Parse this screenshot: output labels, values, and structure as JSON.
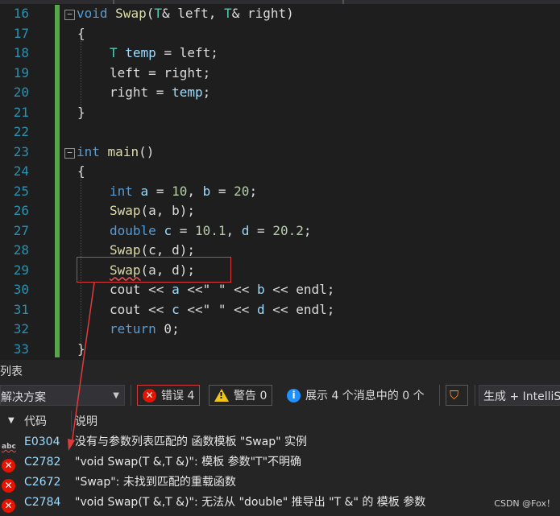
{
  "editor": {
    "line_numbers": [
      "16",
      "17",
      "18",
      "19",
      "20",
      "21",
      "22",
      "23",
      "24",
      "25",
      "26",
      "27",
      "28",
      "29",
      "30",
      "31",
      "32",
      "33"
    ],
    "code": {
      "l16": {
        "kw": "void",
        "fn": "Swap",
        "rest1": "(",
        "ty1": "T",
        "rest2": "& left, ",
        "ty2": "T",
        "rest3": "& right)"
      },
      "l17": "{",
      "l18": {
        "ty": "T",
        "var": "temp",
        "rest": " = left;"
      },
      "l19": "left = right;",
      "l20": {
        "rest": "right = ",
        "var": "temp",
        "end": ";"
      },
      "l21": "}",
      "l23": {
        "kw": "int",
        "fn": "main",
        "rest": "()"
      },
      "l24": "{",
      "l25": {
        "kw": "int",
        "a": "a",
        "eq1": " = ",
        "n1": "10",
        "c": ", ",
        "b": "b",
        "eq2": " = ",
        "n2": "20",
        "end": ";"
      },
      "l26": {
        "fn": "Swap",
        "args": "(a, b);"
      },
      "l27": {
        "kw": "double",
        "c": "c",
        "eq1": " = ",
        "n1": "10.1",
        "s": ", ",
        "d": "d",
        "eq2": " = ",
        "n2": "20.2",
        "end": ";"
      },
      "l28": {
        "fn": "Swap",
        "args": "(c, d);"
      },
      "l29": {
        "fn": "Swap",
        "args": "(a, d);"
      },
      "l30": {
        "p1": "cout << ",
        "v1": "a",
        "p2": " <<\" \" << ",
        "v2": "b",
        "p3": " << endl;"
      },
      "l31": {
        "p1": "cout << ",
        "v1": "c",
        "p2": " <<\" \" << ",
        "v2": "d",
        "p3": " << endl;"
      },
      "l32": {
        "kw": "return",
        "rest": " 0;"
      },
      "l33": "}"
    }
  },
  "error_list": {
    "title": "列表",
    "scope": "解决方案",
    "errors_label": "错误 4",
    "warnings_label": "警告 0",
    "messages_label": "展示 4 个消息中的 0 个",
    "build_label": "生成 + IntelliS",
    "col_code": "代码",
    "col_desc": "说明",
    "rows": [
      {
        "code": "E0304",
        "desc": "没有与参数列表匹配的 函数模板 \"Swap\" 实例",
        "icon": "abc-spell-icon"
      },
      {
        "code": "C2782",
        "desc": "\"void Swap(T &,T &)\": 模板 参数\"T\"不明确",
        "icon": "error-icon"
      },
      {
        "code": "C2672",
        "desc": "\"Swap\": 未找到匹配的重载函数",
        "icon": "error-icon"
      },
      {
        "code": "C2784",
        "desc": "\"void Swap(T &,T &)\": 无法从 \"double\" 推导出 \"T &\" 的 模板 参数",
        "icon": "error-icon"
      }
    ]
  },
  "watermark": "CSDN @Fox！",
  "colors": {
    "keyword": "#569cd6",
    "type": "#4ec9b0",
    "function": "#dcdcaa",
    "variable": "#9cdcfe",
    "number": "#b5cea8",
    "highlight": "#e03b3b",
    "error": "#e51400"
  }
}
